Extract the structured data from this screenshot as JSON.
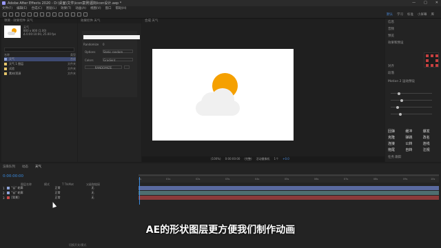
{
  "window": {
    "title": "Adobe After Effects 2020 - D:\\桌面\\文件\\icon案例\\图标icon设计.aep *",
    "controls": [
      "—",
      "□",
      "✕"
    ]
  },
  "menu": [
    "文件(F)",
    "编辑(E)",
    "合成(C)",
    "图层(L)",
    "效果(T)",
    "动画(A)",
    "视图(V)",
    "窗口",
    "帮助(H)"
  ],
  "toolbar": {
    "workspaces": [
      "默认",
      "学习",
      "标准",
      "小屏幕",
      "库"
    ],
    "active_workspace": "默认"
  },
  "project": {
    "header": "项目 · 效果控件 天气",
    "item_name": "天气",
    "item_meta": [
      "800 x 800 (1.00)",
      "Δ 0:00:10:00, 25.00 fps"
    ],
    "columns": [
      "名称",
      "类型"
    ],
    "rows": [
      {
        "name": "天气",
        "type": "合成",
        "color": "#8fa4d8",
        "selected": true
      },
      {
        "name": "天气 1 图层",
        "type": "文件夹",
        "color": "#e3c46a",
        "selected": false
      },
      {
        "name": "试验",
        "type": "文件夹",
        "color": "#e3c46a",
        "selected": false
      },
      {
        "name": "素材/资源",
        "type": "文件夹",
        "color": "#e3c46a",
        "selected": false
      }
    ]
  },
  "effect_controls": {
    "header": "效果控件 天气",
    "fields": [
      {
        "label": "Randomize",
        "value": "0"
      },
      {
        "label": "Options",
        "value": "Static random"
      },
      {
        "label": "Colors",
        "value": "Gradient"
      }
    ],
    "button": "RANDOMIZE"
  },
  "composition": {
    "header": "合成 天气",
    "zoom": "(100%)",
    "timecode": "0:00:00:00",
    "quality": "(完整)",
    "camera": "活动摄像机",
    "views": "1个",
    "exposure": "+0.0"
  },
  "right_panel": {
    "headers": [
      "信息",
      "音频",
      "预览",
      "效果和预设",
      "对齐",
      "段落"
    ],
    "motion_label": "Motion 2 运动预设",
    "fx": [
      "回弹",
      "缓冲",
      "爆发",
      "克隆",
      "弹跳",
      "改名",
      "连接",
      "公转",
      "连线",
      "拖尾",
      "自转",
      "注视"
    ],
    "task_label": "任务 跟踪"
  },
  "timeline": {
    "tabs": [
      "渲染队列",
      "动态",
      "天气"
    ],
    "active_tab": "天气",
    "time": "0:00:00:00",
    "columns": [
      "图层名称",
      "模式",
      "T TrkMat",
      "父级和链接"
    ],
    "layers": [
      {
        "num": "1",
        "name": "\"云\" 轮廓",
        "mode": "正常",
        "parent": "无",
        "color": "#8fa4d8",
        "track": "#5a6aa0"
      },
      {
        "num": "2",
        "name": "\"云\" 轮廓",
        "mode": "正常",
        "parent": "无",
        "color": "#8fa4d8",
        "track": "#4e6e70"
      },
      {
        "num": "3",
        "name": "[背景]",
        "mode": "正常",
        "parent": "无",
        "color": "#c84a4a",
        "track": "#8a3a3a"
      }
    ],
    "ruler": [
      "0s",
      "01s",
      "02s",
      "03s",
      "04s",
      "05s",
      "06s",
      "07s",
      "08s",
      "09s",
      "10s"
    ],
    "footer": "切换开关/模式"
  },
  "subtitle": "AE的形状图层更方便我们制作动画"
}
